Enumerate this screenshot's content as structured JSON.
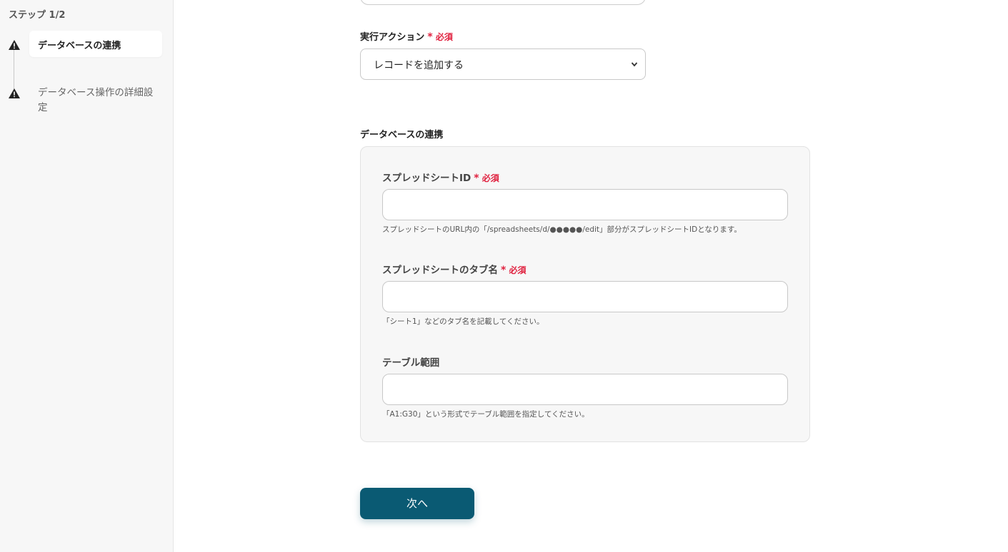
{
  "sidebar": {
    "step_count": "ステップ 1/2",
    "steps": [
      {
        "label": "データベースの連携",
        "active": true,
        "icon": "warning-icon"
      },
      {
        "label": "データベース操作の詳細設定",
        "active": false,
        "icon": "warning-icon"
      }
    ]
  },
  "form": {
    "action": {
      "label": "実行アクション",
      "required": "必須",
      "value": "レコードを追加する"
    },
    "section_title": "データベースの連携",
    "spreadsheet_id": {
      "label": "スプレッドシートID",
      "required": "必須",
      "value": "",
      "hint": "スプレッドシートのURL内の「/spreadsheets/d/●●●●●/edit」部分がスプレッドシートIDとなります。"
    },
    "tab_name": {
      "label": "スプレッドシートのタブ名",
      "required": "必須",
      "value": "",
      "hint": "「シート1」などのタブ名を記載してください。"
    },
    "table_range": {
      "label": "テーブル範囲",
      "value": "",
      "hint": "「A1:G30」という形式でテーブル範囲を指定してください。"
    },
    "next_button": "次へ"
  },
  "colors": {
    "accent": "#0a5a73",
    "required": "#e0213f",
    "sidebar_bg": "#f7f7f7"
  }
}
